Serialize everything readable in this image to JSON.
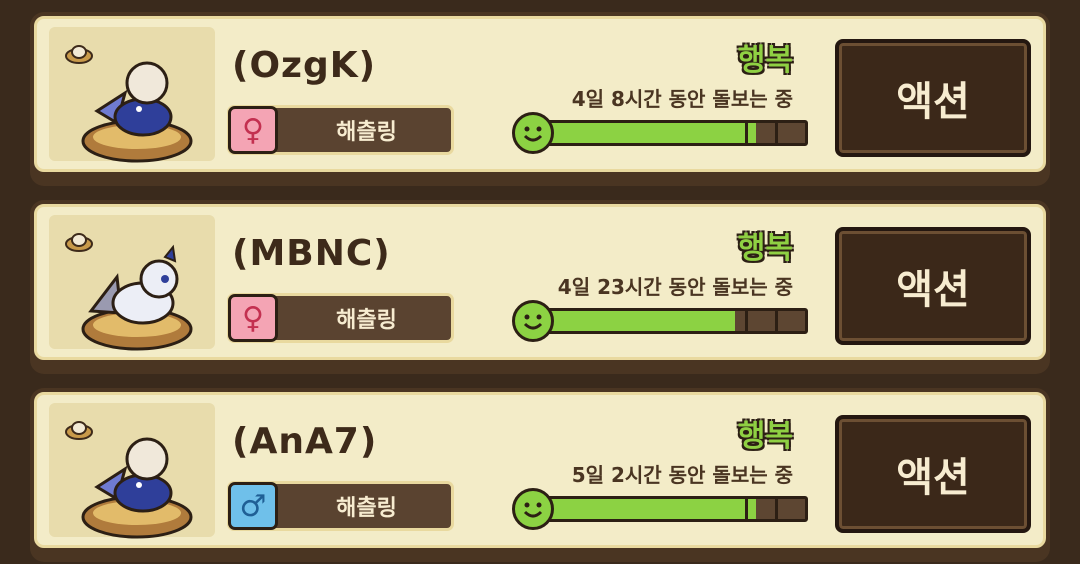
{
  "pets": [
    {
      "name": "(OzgK)",
      "gender": "female",
      "gender_symbol": "♀",
      "stage": "해츨링",
      "mood": "행복",
      "care_text": "4일 8시간 동안 돌보는 중",
      "happiness_fraction": 0.82,
      "action_label": "액션",
      "colors": {
        "body": "#2f3f9a",
        "wing": "#6f7bd1",
        "egg": "#f0e8da"
      }
    },
    {
      "name": "(MBNC)",
      "gender": "female",
      "gender_symbol": "♀",
      "stage": "해츨링",
      "mood": "행복",
      "care_text": "4일 23시간 동안 돌보는 중",
      "happiness_fraction": 0.74,
      "action_label": "액션",
      "colors": {
        "body": "#eceef6",
        "wing": "#9a9ab0",
        "egg": "#f0e8da"
      }
    },
    {
      "name": "(AnA7)",
      "gender": "male",
      "gender_symbol": "♂",
      "stage": "해츨링",
      "mood": "행복",
      "care_text": "5일 2시간 동안 돌보는 중",
      "happiness_fraction": 0.82,
      "action_label": "액션",
      "colors": {
        "body": "#2f3f9a",
        "wing": "#6f7bd1",
        "egg": "#f0e8da"
      }
    }
  ],
  "icons": {
    "coin": "egg-coin-icon",
    "smiley": "happy-face-icon",
    "female": "female-symbol-icon",
    "male": "male-symbol-icon"
  },
  "accent_colors": {
    "mood_green": "#8fd043",
    "panel": "#f3ecc8",
    "frame": "#4a3522"
  }
}
